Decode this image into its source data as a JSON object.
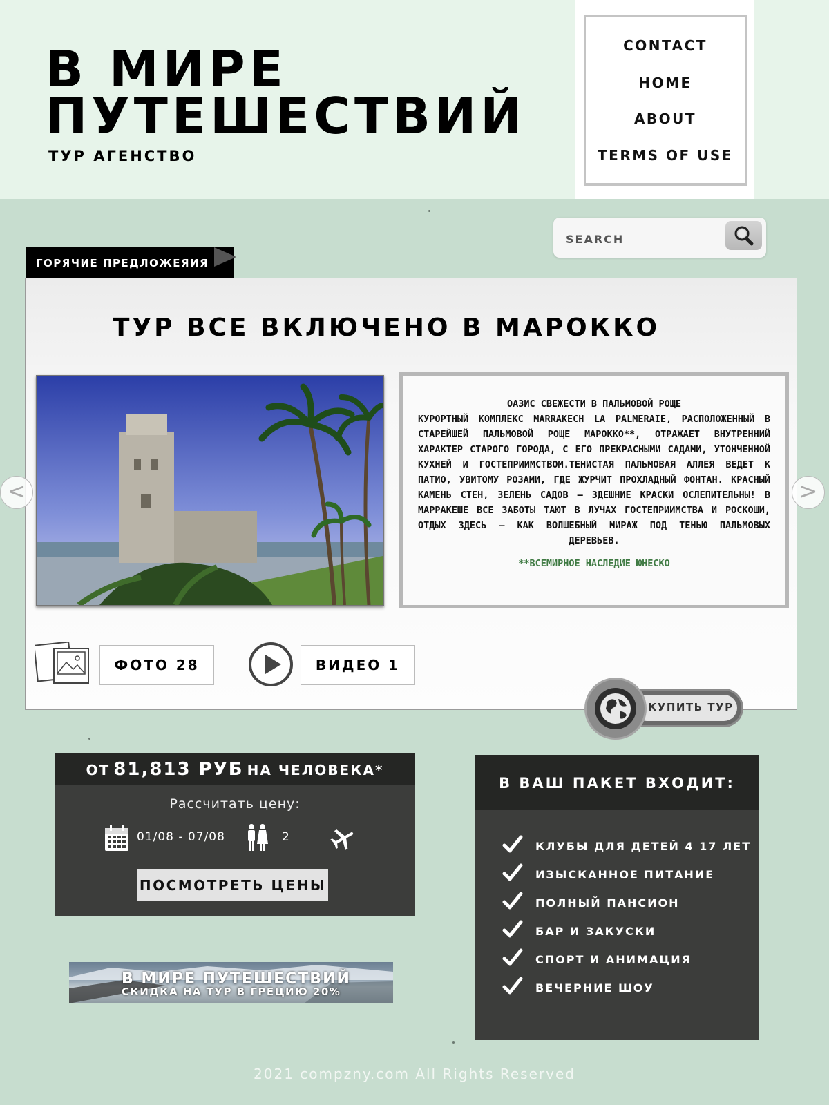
{
  "brand": {
    "title_line1": "В МИРЕ",
    "title_line2": "ПУТЕШЕСТВИЙ",
    "tagline": "ТУР АГЕНСТВО"
  },
  "nav": {
    "items": [
      {
        "label": "CONTACT"
      },
      {
        "label": "HOME"
      },
      {
        "label": "ABOUT"
      },
      {
        "label": "TERMS OF USE"
      }
    ]
  },
  "search": {
    "placeholder": "SEARCH",
    "icon": "magnifier-icon"
  },
  "hot_offers": {
    "tag": "ГОРЯЧИЕ ПРЕДЛОЖЕЯИЯ"
  },
  "tour": {
    "title": "ТУР ВСЕ ВКЛЮЧЕНО В МАРОККО",
    "desc_title": "ОАЗИС СВЕЖЕСТИ В ПАЛЬМОВОЙ РОЩЕ",
    "desc_body": "КУРОРТНЫЙ КОМПЛЕКС MARRAKECH LA PALMERAIE, РАСПОЛОЖЕННЫЙ В СТАРЕЙШЕЙ ПАЛЬМОВОЙ РОЩЕ МАРОККО**, ОТРАЖАЕТ ВНУТРЕННИЙ ХАРАКТЕР СТАРОГО ГОРОДА, С ЕГО ПРЕКРАСНЫМИ САДАМИ, УТОНЧЕННОЙ КУХНЕЙ И ГОСТЕПРИИМСТВОМ.ТЕНИСТАЯ ПАЛЬМОВАЯ АЛЛЕЯ ВЕДЕТ К ПАТИО, УВИТОМУ РОЗАМИ, ГДЕ ЖУРЧИТ ПРОХЛАДНЫЙ ФОНТАН. КРАСНЫЙ КАМЕНЬ СТЕН, ЗЕЛЕНЬ САДОВ — ЗДЕШНИЕ КРАСКИ ОСЛЕПИТЕЛЬНЫ! В МАРРАКЕШЕ ВСЕ ЗАБОТЫ ТАЮТ В ЛУЧАХ ГОСТЕПРИИМСТВА И РОСКОШИ, ОТДЫХ ЗДЕСЬ — КАК ВОЛШЕБНЫЙ МИРАЖ ПОД ТЕНЬЮ ПАЛЬМОВЫХ ДЕРЕВЬЕВ.",
    "desc_note": "**ВСЕМИРНОЕ НАСЛЕДИЕ ЮНЕСКО",
    "photo_button": "ФОТО 28",
    "video_button": "ВИДЕО 1",
    "buy_button": "КУПИТЬ ТУР",
    "prev_arrow": "<",
    "next_arrow": ">"
  },
  "price": {
    "prefix": "ОТ",
    "amount": "81,813 РУБ",
    "suffix": "НА ЧЕЛОВЕКА*",
    "calc_label": "Рассчитать цену:",
    "dates": "01/08 - 07/08",
    "people": "2",
    "button": "ПОСМОТРЕТЬ ЦЕНЫ"
  },
  "banner": {
    "line1": "В МИРЕ ПУТЕШЕСТВИЙ",
    "line2": "СКИДКА НА ТУР В ГРЕЦИЮ 20%"
  },
  "package": {
    "title": "В ВАШ ПАКЕТ ВХОДИТ:",
    "items": [
      "КЛУБЫ ДЛЯ ДЕТЕЙ 4 17 ЛЕТ",
      "ИЗЫСКАННОЕ ПИТАНИЕ",
      "ПОЛНЫЙ ПАНСИОН",
      "БАР И ЗАКУСКИ",
      "СПОРТ И АНИМАЦИЯ",
      "ВЕЧЕРНИЕ ШОУ"
    ]
  },
  "footer": {
    "text": "2021 compzny.com All Rights Reserved"
  },
  "colors": {
    "header_bg": "#e7f4ea",
    "page_bg": "#c7ddcf",
    "dark_panel": "#3c3d3b",
    "dark_head": "#252624",
    "note_green": "#3f7a43"
  }
}
